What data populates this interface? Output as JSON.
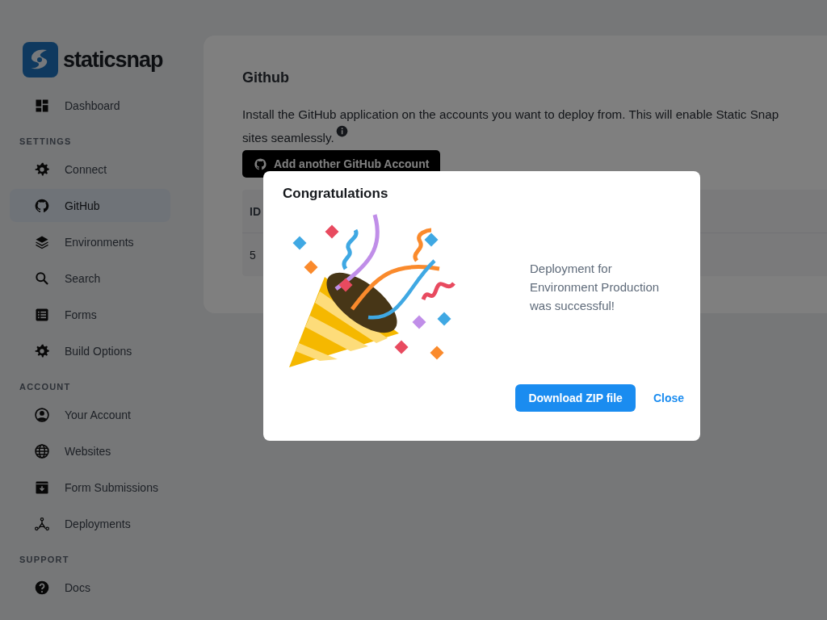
{
  "sidebar": {
    "logo": "staticsnap",
    "sections": [
      {
        "items": [
          {
            "label": "Dashboard",
            "selected": false
          }
        ]
      },
      {
        "heading": "SETTINGS",
        "items": [
          {
            "label": "Connect",
            "selected": false
          },
          {
            "label": "GitHub",
            "selected": true
          },
          {
            "label": "Environments",
            "selected": false
          },
          {
            "label": "Search",
            "selected": false
          },
          {
            "label": "Forms",
            "selected": false
          },
          {
            "label": "Build Options",
            "selected": false
          }
        ]
      },
      {
        "heading": "ACCOUNT",
        "items": [
          {
            "label": "Your Account",
            "selected": false
          },
          {
            "label": "Websites",
            "selected": false
          },
          {
            "label": "Form Submissions",
            "selected": false
          },
          {
            "label": "Deployments",
            "selected": false
          }
        ]
      },
      {
        "heading": "SUPPORT",
        "items": [
          {
            "label": "Docs",
            "selected": false
          }
        ]
      }
    ]
  },
  "main": {
    "title": "Github",
    "description_lines": [
      "Install the GitHub application on the accounts you want to deploy from. This will enable Static Snap",
      "sites seamlessly."
    ],
    "add_button": "Add another GitHub Account",
    "table": {
      "columns": [
        "ID"
      ],
      "rows": [
        [
          "5"
        ]
      ]
    }
  },
  "dialog": {
    "title": "Congratulations",
    "message": "Deployment for Environment Production was successful!",
    "buttons": [
      {
        "label": "Download ZIP file",
        "kind": "primary"
      },
      {
        "label": "Close",
        "kind": "text"
      }
    ]
  }
}
